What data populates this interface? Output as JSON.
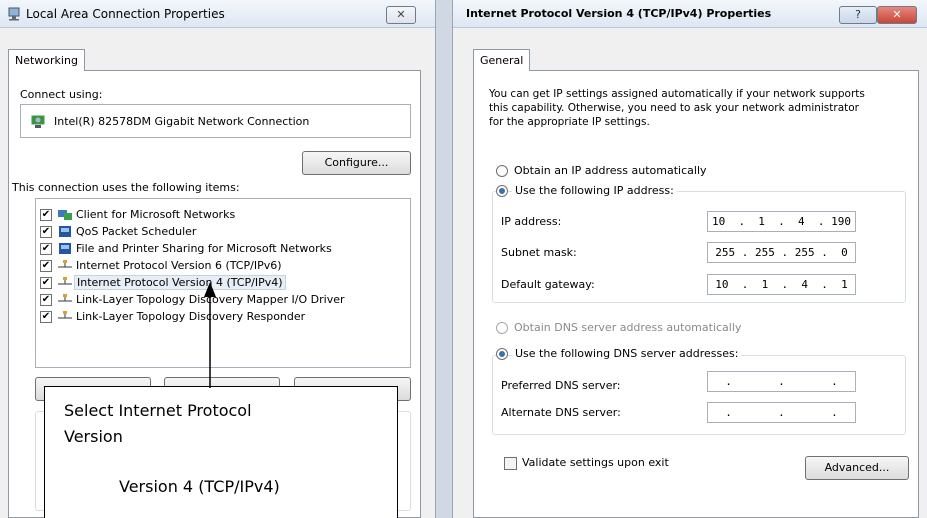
{
  "left_dialog": {
    "title": "Local Area Connection Properties",
    "tab": "Networking",
    "connect_using_label": "Connect using:",
    "adapter_name": "Intel(R) 82578DM Gigabit Network Connection",
    "configure_button": "Configure...",
    "items_label": "This connection uses the following items:",
    "items": [
      {
        "label": "Client for Microsoft Networks",
        "checked": true,
        "icon": "network-client-icon"
      },
      {
        "label": "QoS Packet Scheduler",
        "checked": true,
        "icon": "network-service-icon"
      },
      {
        "label": "File and Printer Sharing for Microsoft Networks",
        "checked": true,
        "icon": "network-service-icon"
      },
      {
        "label": "Internet Protocol Version 6 (TCP/IPv6)",
        "checked": true,
        "icon": "protocol-icon"
      },
      {
        "label": "Internet Protocol Version 4 (TCP/IPv4)",
        "checked": true,
        "icon": "protocol-icon",
        "selected": true
      },
      {
        "label": "Link-Layer Topology Discovery Mapper I/O Driver",
        "checked": true,
        "icon": "protocol-icon"
      },
      {
        "label": "Link-Layer Topology Discovery Responder",
        "checked": true,
        "icon": "protocol-icon"
      }
    ],
    "close_glyph": "✕",
    "checkmark_glyph": "✔"
  },
  "right_dialog": {
    "title": "Internet Protocol Version 4 (TCP/IPv4) Properties",
    "tab": "General",
    "description": [
      "You can get IP settings assigned automatically if your network supports",
      "this capability. Otherwise, you need to ask your network administrator",
      "for the appropriate IP settings."
    ],
    "obtain_ip_auto": "Obtain an IP address automatically",
    "use_following_ip": "Use the following IP address:",
    "ip_address_label": "IP address:",
    "ip_address_value": "10  .  1  .  4  . 190",
    "subnet_mask_label": "Subnet mask:",
    "subnet_mask_value": "255 . 255 . 255 .  0",
    "default_gateway_label": "Default gateway:",
    "default_gateway_value": "10  .  1  .  4  .  1",
    "obtain_dns_auto": "Obtain DNS server address automatically",
    "use_following_dns": "Use the following DNS server addresses:",
    "preferred_dns_label": "Preferred DNS server:",
    "preferred_dns_value": ".       .       .",
    "alternate_dns_label": "Alternate DNS server:",
    "alternate_dns_value": ".       .       .",
    "validate_label": "Validate settings upon exit",
    "advanced_button": "Advanced...",
    "help_glyph": "?",
    "close_glyph": "✕"
  },
  "callout": {
    "line1": "Select Internet Protocol",
    "line2": "Version",
    "line3": "Version 4 (TCP/IPv4)"
  },
  "colors": {
    "selection_highlight": "#e8eef6",
    "close_button_red": "#c7453a",
    "accent_blue": "#3b6fb0"
  }
}
